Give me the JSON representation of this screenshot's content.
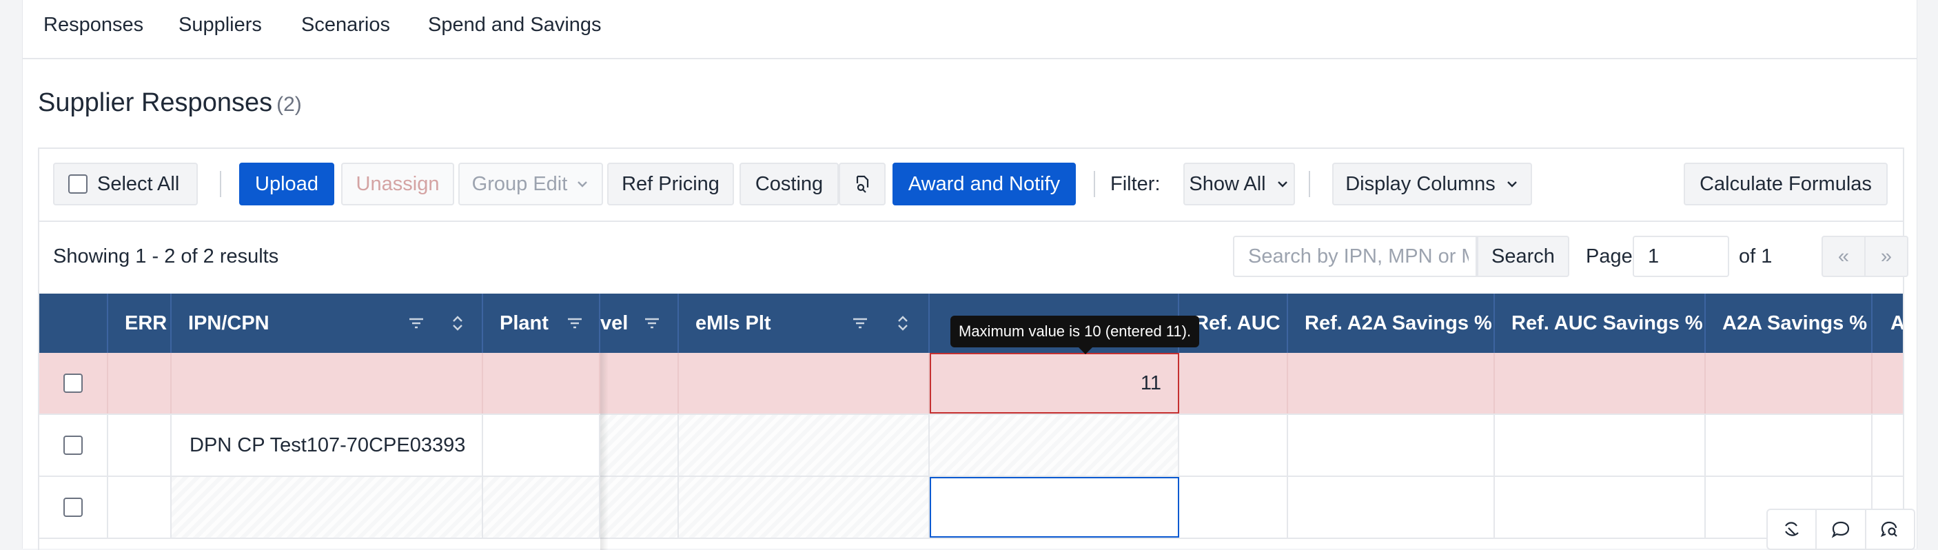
{
  "tabs": [
    "Responses",
    "Suppliers",
    "Scenarios",
    "Spend and Savings"
  ],
  "section": {
    "title": "Supplier Responses",
    "count": "(2)"
  },
  "toolbar": {
    "select_all": "Select All",
    "upload": "Upload",
    "unassign": "Unassign",
    "group_edit": "Group Edit",
    "ref_pricing": "Ref Pricing",
    "costing": "Costing",
    "award_notify": "Award and Notify",
    "filter_label": "Filter:",
    "filter_value": "Show All",
    "display_columns": "Display Columns",
    "calculate": "Calculate Formulas"
  },
  "results": {
    "summary": "Showing 1 - 2 of 2 results",
    "search_placeholder": "Search by IPN, MPN or Mfr",
    "search_button": "Search",
    "page_label": "Page",
    "page_value": "1",
    "of_label": "of 1",
    "first": "«",
    "last": "»"
  },
  "columns": [
    "ERR",
    "IPN/CPN",
    "Plant",
    "vel",
    "eMls Plt",
    "Ref. AUC",
    "Ref. A2A Savings %",
    "Ref. AUC Savings %",
    "A2A Savings %",
    "AU"
  ],
  "rows": [
    {
      "ipn": "",
      "value": "11"
    },
    {
      "ipn": "DPN CP Test107-70CPE03393",
      "value": ""
    },
    {
      "ipn": "",
      "value": ""
    }
  ],
  "tooltip": "Maximum value is 10 (entered 11).",
  "colors": {
    "primary": "#0b5ad1",
    "header": "#2c5282",
    "error_row": "#f4d7d9",
    "error_border": "#c53030"
  }
}
